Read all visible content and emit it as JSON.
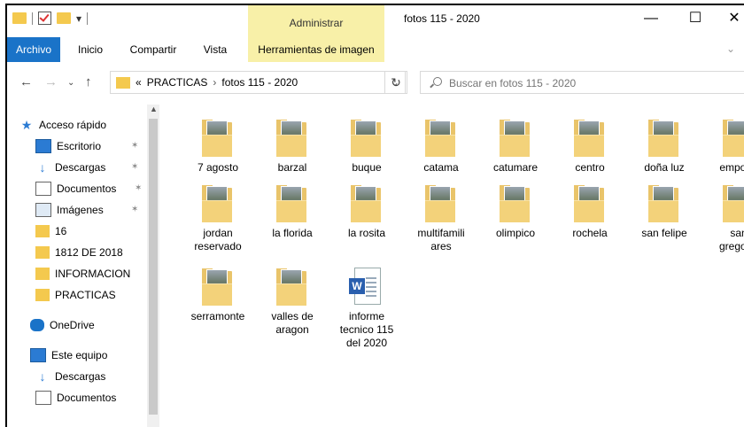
{
  "window": {
    "title": "fotos 115 - 2020",
    "context_tab": "Administrar",
    "minimize_label": "—",
    "maximize_label": "☐",
    "close_label": "✕"
  },
  "ribbon": {
    "tabs": [
      "Archivo",
      "Inicio",
      "Compartir",
      "Vista",
      "Herramientas de imagen"
    ],
    "expand_label": "⌄"
  },
  "address": {
    "path_prefix": "«",
    "crumbs": [
      "PRACTICAS",
      "fotos 115 - 2020"
    ],
    "search_placeholder": "Buscar en fotos 115 - 2020"
  },
  "nav": {
    "items": [
      {
        "label": "Acceso rápido",
        "icon": "star-icon"
      },
      {
        "label": "Escritorio",
        "icon": "desktop-icon",
        "pinned": true
      },
      {
        "label": "Descargas",
        "icon": "download-icon",
        "pinned": true
      },
      {
        "label": "Documentos",
        "icon": "document-icon",
        "pinned": true
      },
      {
        "label": "Imágenes",
        "icon": "pictures-icon",
        "pinned": true
      },
      {
        "label": "16",
        "icon": "folder-icon"
      },
      {
        "label": "1812 DE 2018",
        "icon": "folder-icon"
      },
      {
        "label": "INFORMACION",
        "icon": "folder-icon"
      },
      {
        "label": "PRACTICAS",
        "icon": "folder-icon"
      },
      {
        "label": "OneDrive",
        "icon": "cloud-icon"
      },
      {
        "label": "Este equipo",
        "icon": "computer-icon"
      },
      {
        "label": "Descargas",
        "icon": "download-icon"
      },
      {
        "label": "Documentos",
        "icon": "document-icon"
      }
    ]
  },
  "files": [
    {
      "name": "7 agosto",
      "type": "folder"
    },
    {
      "name": "barzal",
      "type": "folder"
    },
    {
      "name": "buque",
      "type": "folder"
    },
    {
      "name": "catama",
      "type": "folder"
    },
    {
      "name": "catumare",
      "type": "folder"
    },
    {
      "name": "centro",
      "type": "folder"
    },
    {
      "name": "doña luz",
      "type": "folder"
    },
    {
      "name": "emporio",
      "type": "folder"
    },
    {
      "name": "jordan\nreservado",
      "type": "folder"
    },
    {
      "name": "la florida",
      "type": "folder"
    },
    {
      "name": "la rosita",
      "type": "folder"
    },
    {
      "name": "multifamili\nares",
      "type": "folder"
    },
    {
      "name": "olimpico",
      "type": "folder"
    },
    {
      "name": "rochela",
      "type": "folder"
    },
    {
      "name": "san felipe",
      "type": "folder"
    },
    {
      "name": "san\ngregorio",
      "type": "folder"
    },
    {
      "name": "serramonte",
      "type": "folder"
    },
    {
      "name": "valles de\naragon",
      "type": "folder"
    },
    {
      "name": "informe\ntecnico 115\ndel 2020",
      "type": "word-document"
    }
  ]
}
